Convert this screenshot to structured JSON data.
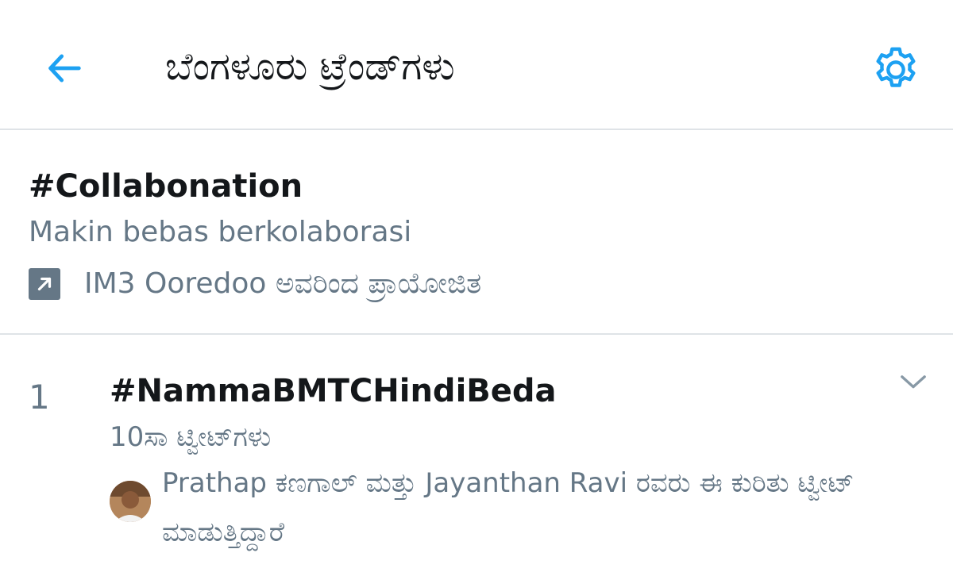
{
  "header": {
    "title": "ಬೆಂಗಳೂರು ಟ್ರೆಂಡ್‌ಗಳು",
    "back_icon": "arrow-left-icon",
    "settings_icon": "gear-icon",
    "accent_color": "#1da1f2"
  },
  "promoted": {
    "hashtag": "#Collabonation",
    "description": "Makin bebas berkolaborasi",
    "sponsor_text": "IM3 Ooredoo ಅವರಿಂದ ಪ್ರಾಯೋಜಿತ",
    "sponsor_icon": "promoted-arrow-icon"
  },
  "trends": [
    {
      "rank": "1",
      "name": "#NammaBMTCHindiBeda",
      "count": "10ಸಾ ಟ್ವೀಟ್‌ಗಳು",
      "context": "Prathap ಕಣಗಾಲ್ ಮತ್ತು Jayanthan Ravi ರವರು ಈ ಕುರಿತು ಟ್ವೀಟ್ ಮಾಡುತ್ತಿದ್ದಾರೆ",
      "caret_icon": "chevron-down-icon"
    }
  ]
}
